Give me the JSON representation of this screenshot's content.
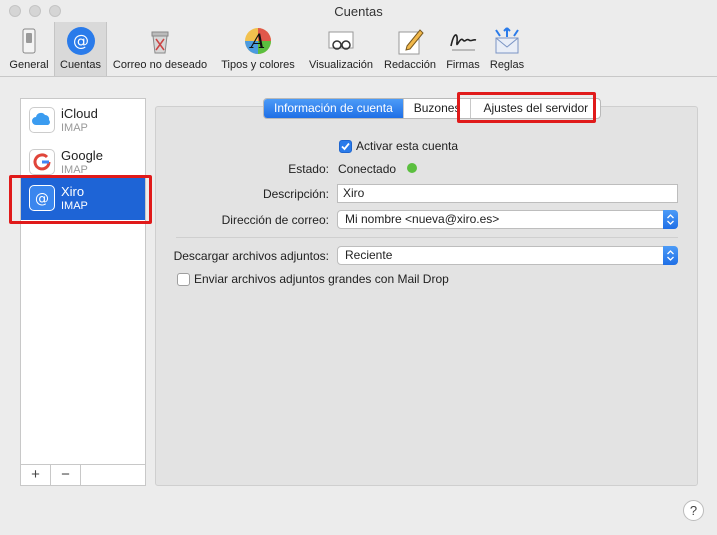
{
  "window": {
    "title": "Cuentas"
  },
  "toolbar": {
    "items": [
      {
        "label": "General",
        "icon": "switch-icon"
      },
      {
        "label": "Cuentas",
        "icon": "at-sign-icon"
      },
      {
        "label": "Correo no deseado",
        "icon": "trash-bin-icon"
      },
      {
        "label": "Tipos y colores",
        "icon": "font-palette-icon"
      },
      {
        "label": "Visualización",
        "icon": "glasses-envelope-icon"
      },
      {
        "label": "Redacción",
        "icon": "pencil-paper-icon"
      },
      {
        "label": "Firmas",
        "icon": "signature-icon"
      },
      {
        "label": "Reglas",
        "icon": "rules-envelope-icon"
      }
    ],
    "selected": "Cuentas"
  },
  "sidebar": {
    "accounts": [
      {
        "name": "iCloud",
        "type": "IMAP",
        "icon": "cloud-icon"
      },
      {
        "name": "Google",
        "type": "IMAP",
        "icon": "google-icon"
      },
      {
        "name": "Xiro",
        "type": "IMAP",
        "icon": "at-sign-icon",
        "selected": true
      }
    ],
    "add_label": "+",
    "remove_label": "−"
  },
  "tabs": [
    {
      "label": "Información de cuenta",
      "active": true
    },
    {
      "label": "Buzones",
      "active": false
    },
    {
      "label": "Ajustes del servidor",
      "active": false
    }
  ],
  "form": {
    "activate_label": "Activar esta cuenta",
    "activate_checked": true,
    "status_label": "Estado:",
    "status_value": "Conectado",
    "status_color": "#5bbf3f",
    "description_label": "Descripción:",
    "description_value": "Xiro",
    "email_label": "Dirección de correo:",
    "email_value": "Mi nombre <nueva@xiro.es>",
    "attachments_label": "Descargar archivos adjuntos:",
    "attachments_value": "Reciente",
    "maildrop_label": "Enviar archivos adjuntos grandes con Mail Drop",
    "maildrop_checked": false
  },
  "help_label": "?",
  "colors": {
    "accent": "#1e64d6",
    "highlight": "#e01a1a"
  }
}
